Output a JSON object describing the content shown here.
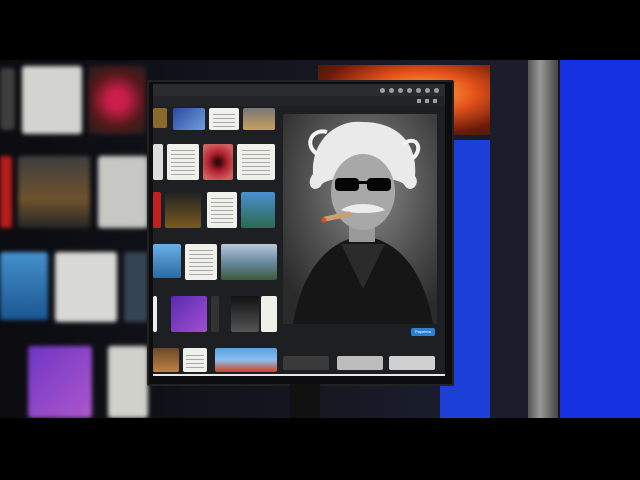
{
  "preview": {
    "open_label": "Papelera"
  },
  "statusbar": {
    "clock": ""
  },
  "colors": {
    "accent_button": "#2a7fd6",
    "blue_panel": "#1430e0"
  }
}
